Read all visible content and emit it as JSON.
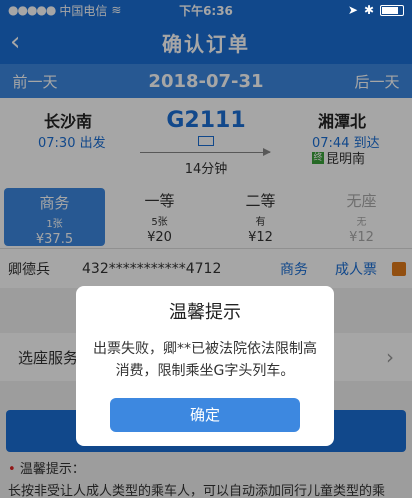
{
  "status": {
    "carrier": "中国电信",
    "time": "下午6:36"
  },
  "nav": {
    "back_icon": "chevron-left-icon",
    "title": "确认订单"
  },
  "date_bar": {
    "prev": "前一天",
    "date": "2018-07-31",
    "next": "后一天"
  },
  "train": {
    "from_station": "长沙南",
    "from_time": "07:30 出发",
    "train_no": "G2111",
    "duration": "14分钟",
    "to_station": "湘潭北",
    "to_time": "07:44 到达",
    "via_badge": "终",
    "via": "昆明南"
  },
  "seats": [
    {
      "name": "商务",
      "count": "1张",
      "price": "¥37.5"
    },
    {
      "name": "一等",
      "count": "5张",
      "price": "¥20"
    },
    {
      "name": "二等",
      "count": "有",
      "price": "¥12"
    },
    {
      "name": "无座",
      "count": "无",
      "price": "¥12"
    }
  ],
  "passenger": {
    "name": "卿德兵",
    "id": "432***********4712",
    "seat_type": "商务",
    "ticket_type": "成人票"
  },
  "seat_select": {
    "label": "选座服务"
  },
  "notice": {
    "title": "温馨提示：",
    "text": "长按非受让人成人类型的乘车人，可以自动添加同行儿童类型的乘"
  },
  "dialog": {
    "title": "温馨提示",
    "message": "出票失败，卿**已被法院依法限制高消费，限制乘坐G字头列车。",
    "confirm": "确定"
  }
}
